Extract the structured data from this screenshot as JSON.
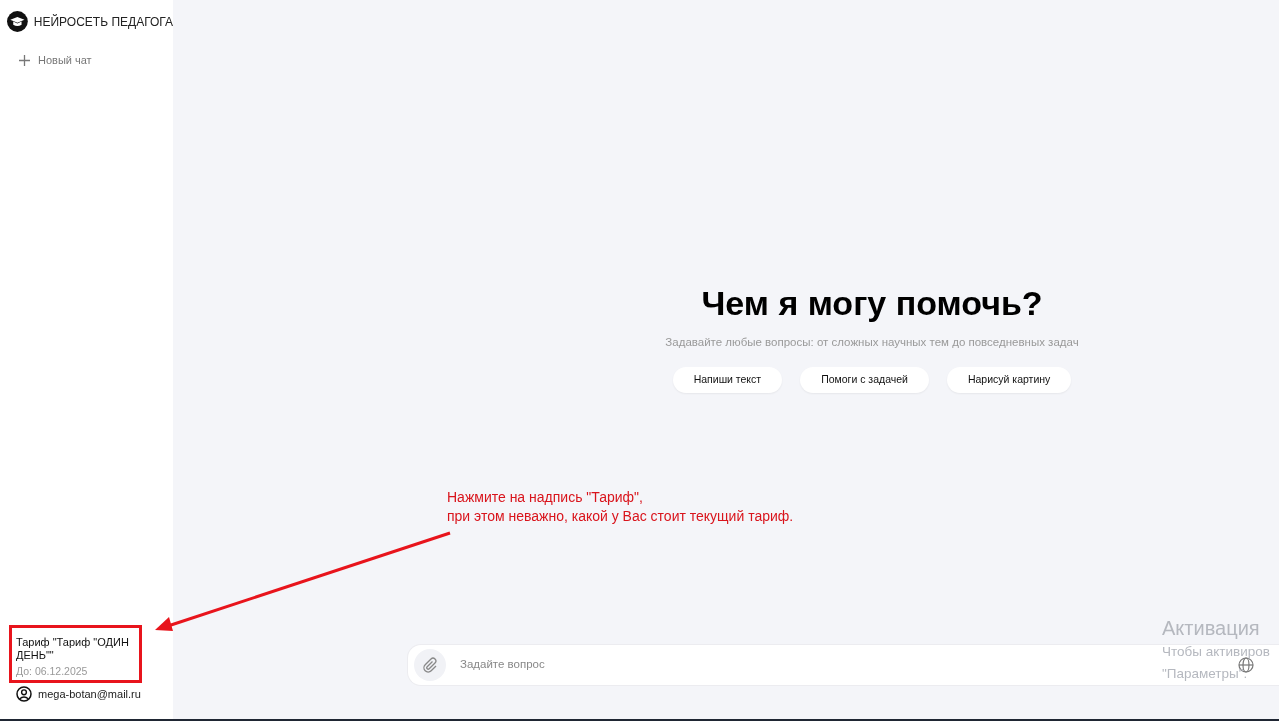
{
  "sidebar": {
    "brand": "НЕЙРОСЕТЬ ПЕДАГОГА",
    "new_chat": "Новый чат",
    "tariff": {
      "name": "Тариф \"Тариф \"ОДИН ДЕНЬ\"\"",
      "until": "До: 06.12.2025"
    },
    "account": "mega-botan@mail.ru"
  },
  "main": {
    "heading": "Чем я могу помочь?",
    "subtitle": "Задавайте любые вопросы: от сложных научных тем до повседневных задач",
    "suggestions": [
      "Напиши текст",
      "Помоги с задачей",
      "Нарисуй картину"
    ],
    "input": {
      "placeholder": "Задайте вопрос"
    }
  },
  "annotation": {
    "lines": [
      "Нажмите на надпись \"Тариф\",",
      "при этом неважно, какой у Вас стоит текущий тариф."
    ]
  },
  "os_watermark": {
    "title": "Активация",
    "lines": [
      "Чтобы активиров",
      "\"Параметры\"."
    ]
  }
}
